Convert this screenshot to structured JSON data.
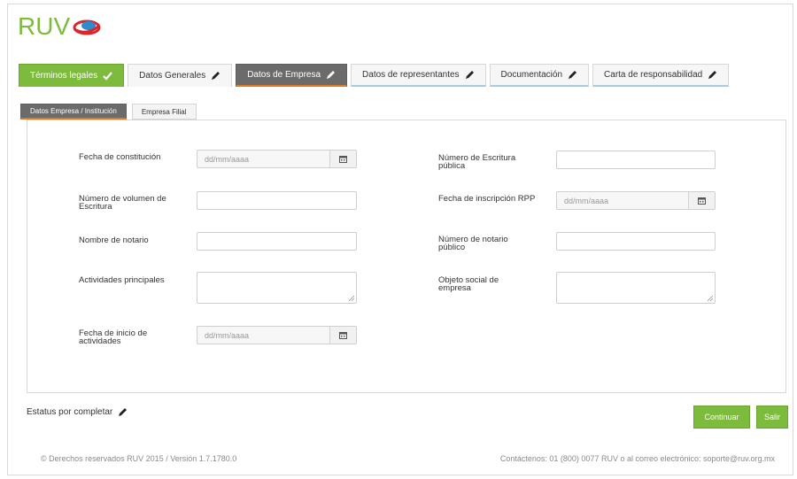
{
  "logo": {
    "text": "RUV"
  },
  "tabs": [
    {
      "label": "Términos legales",
      "state": "done"
    },
    {
      "label": "Datos Generales",
      "state": "normal"
    },
    {
      "label": "Datos de Empresa",
      "state": "active"
    },
    {
      "label": "Datos de representantes",
      "state": "normal"
    },
    {
      "label": "Documentación",
      "state": "normal"
    },
    {
      "label": "Carta de responsabilidad",
      "state": "normal"
    }
  ],
  "subtabs": [
    {
      "label": "Datos Empresa / Institución",
      "state": "active"
    },
    {
      "label": "Empresa Filial",
      "state": "normal"
    }
  ],
  "form": {
    "fecha_constitucion": {
      "label": "Fecha de constitución",
      "placeholder": "dd/mm/aaaa"
    },
    "numero_volumen": {
      "label": "Número de volumen de Escritura",
      "value": ""
    },
    "nombre_notario": {
      "label": "Nombre de notario",
      "value": ""
    },
    "actividades": {
      "label": "Actividades principales",
      "value": ""
    },
    "fecha_inicio": {
      "label": "Fecha de inicio de actividades",
      "placeholder": "dd/mm/aaaa"
    },
    "numero_escritura": {
      "label": "Número de Escritura pública",
      "value": ""
    },
    "fecha_rpp": {
      "label": "Fecha de inscripción RPP",
      "placeholder": "dd/mm/aaaa"
    },
    "numero_notario": {
      "label": "Número de notario público",
      "value": ""
    },
    "objeto_social": {
      "label": "Objeto social de empresa",
      "value": ""
    }
  },
  "status": {
    "label": "Estatus por completar"
  },
  "buttons": {
    "continue": "Continuar",
    "exit": "Salir"
  },
  "footer": {
    "left": "© Derechos reservados RUV 2015 / Versión 1.7.1780.0",
    "right": "Contáctenos: 01 (800) 0077 RUV o al correo electrónico: soporte@ruv.org.mx"
  },
  "colors": {
    "accent_green": "#7dbb3c",
    "active_gray": "#6b6b6b",
    "active_underline": "#e07b25"
  },
  "icons": {
    "edit": "pencil-icon",
    "check": "check-icon",
    "calendar": "calendar-icon"
  }
}
